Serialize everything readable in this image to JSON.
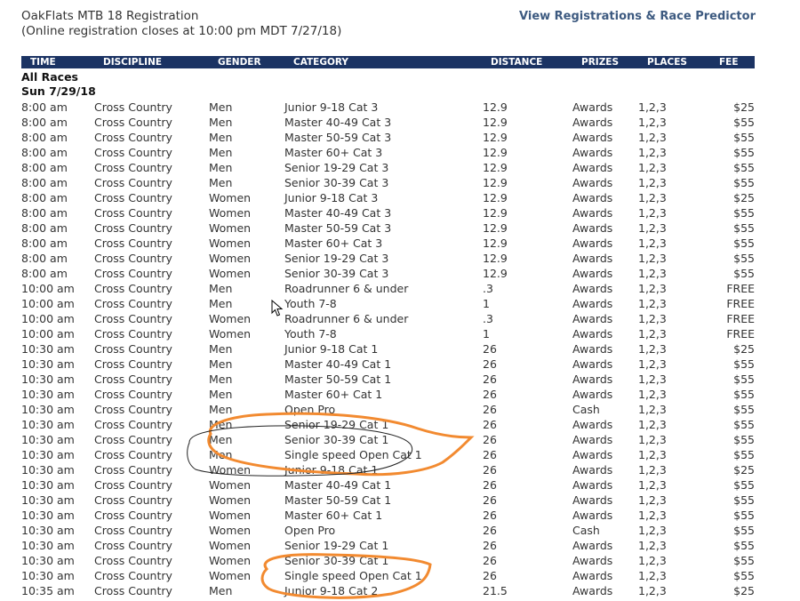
{
  "page": {
    "title": "OakFlats MTB 18 Registration",
    "subtitle": "(Online registration closes at 10:00 pm MDT 7/27/18)",
    "view_link": "View Registrations & Race Predictor"
  },
  "columns": {
    "time": "TIME",
    "discipline": "DISCIPLINE",
    "gender": "GENDER",
    "category": "CATEGORY",
    "distance": "DISTANCE",
    "prizes": "PRIZES",
    "places": "PLACES",
    "fee": "FEE"
  },
  "group": {
    "label": "All Races",
    "date": "Sun 7/29/18"
  },
  "rows": [
    [
      "8:00 am",
      "Cross Country",
      "Men",
      "Junior 9-18 Cat 3",
      "12.9",
      "Awards",
      "1,2,3",
      "$25"
    ],
    [
      "8:00 am",
      "Cross Country",
      "Men",
      "Master 40-49 Cat 3",
      "12.9",
      "Awards",
      "1,2,3",
      "$55"
    ],
    [
      "8:00 am",
      "Cross Country",
      "Men",
      "Master 50-59 Cat 3",
      "12.9",
      "Awards",
      "1,2,3",
      "$55"
    ],
    [
      "8:00 am",
      "Cross Country",
      "Men",
      "Master 60+ Cat 3",
      "12.9",
      "Awards",
      "1,2,3",
      "$55"
    ],
    [
      "8:00 am",
      "Cross Country",
      "Men",
      "Senior 19-29 Cat 3",
      "12.9",
      "Awards",
      "1,2,3",
      "$55"
    ],
    [
      "8:00 am",
      "Cross Country",
      "Men",
      "Senior 30-39 Cat 3",
      "12.9",
      "Awards",
      "1,2,3",
      "$55"
    ],
    [
      "8:00 am",
      "Cross Country",
      "Women",
      "Junior 9-18 Cat 3",
      "12.9",
      "Awards",
      "1,2,3",
      "$25"
    ],
    [
      "8:00 am",
      "Cross Country",
      "Women",
      "Master 40-49 Cat 3",
      "12.9",
      "Awards",
      "1,2,3",
      "$55"
    ],
    [
      "8:00 am",
      "Cross Country",
      "Women",
      "Master 50-59 Cat 3",
      "12.9",
      "Awards",
      "1,2,3",
      "$55"
    ],
    [
      "8:00 am",
      "Cross Country",
      "Women",
      "Master 60+ Cat 3",
      "12.9",
      "Awards",
      "1,2,3",
      "$55"
    ],
    [
      "8:00 am",
      "Cross Country",
      "Women",
      "Senior 19-29 Cat 3",
      "12.9",
      "Awards",
      "1,2,3",
      "$55"
    ],
    [
      "8:00 am",
      "Cross Country",
      "Women",
      "Senior 30-39 Cat 3",
      "12.9",
      "Awards",
      "1,2,3",
      "$55"
    ],
    [
      "10:00 am",
      "Cross Country",
      "Men",
      "Roadrunner 6 & under",
      ".3",
      "Awards",
      "1,2,3",
      "FREE"
    ],
    [
      "10:00 am",
      "Cross Country",
      "Men",
      "Youth 7-8",
      "1",
      "Awards",
      "1,2,3",
      "FREE"
    ],
    [
      "10:00 am",
      "Cross Country",
      "Women",
      "Roadrunner 6 & under",
      ".3",
      "Awards",
      "1,2,3",
      "FREE"
    ],
    [
      "10:00 am",
      "Cross Country",
      "Women",
      "Youth 7-8",
      "1",
      "Awards",
      "1,2,3",
      "FREE"
    ],
    [
      "10:30 am",
      "Cross Country",
      "Men",
      "Junior 9-18 Cat 1",
      "26",
      "Awards",
      "1,2,3",
      "$25"
    ],
    [
      "10:30 am",
      "Cross Country",
      "Men",
      "Master 40-49 Cat 1",
      "26",
      "Awards",
      "1,2,3",
      "$55"
    ],
    [
      "10:30 am",
      "Cross Country",
      "Men",
      "Master 50-59 Cat 1",
      "26",
      "Awards",
      "1,2,3",
      "$55"
    ],
    [
      "10:30 am",
      "Cross Country",
      "Men",
      "Master 60+ Cat 1",
      "26",
      "Awards",
      "1,2,3",
      "$55"
    ],
    [
      "10:30 am",
      "Cross Country",
      "Men",
      "Open Pro",
      "26",
      "Cash",
      "1,2,3",
      "$55"
    ],
    [
      "10:30 am",
      "Cross Country",
      "Men",
      "Senior 19-29 Cat 1",
      "26",
      "Awards",
      "1,2,3",
      "$55"
    ],
    [
      "10:30 am",
      "Cross Country",
      "Men",
      "Senior 30-39 Cat 1",
      "26",
      "Awards",
      "1,2,3",
      "$55"
    ],
    [
      "10:30 am",
      "Cross Country",
      "Men",
      "Single speed Open Cat 1",
      "26",
      "Awards",
      "1,2,3",
      "$55"
    ],
    [
      "10:30 am",
      "Cross Country",
      "Women",
      "Junior 9-18 Cat 1",
      "26",
      "Awards",
      "1,2,3",
      "$25"
    ],
    [
      "10:30 am",
      "Cross Country",
      "Women",
      "Master 40-49 Cat 1",
      "26",
      "Awards",
      "1,2,3",
      "$55"
    ],
    [
      "10:30 am",
      "Cross Country",
      "Women",
      "Master 50-59 Cat 1",
      "26",
      "Awards",
      "1,2,3",
      "$55"
    ],
    [
      "10:30 am",
      "Cross Country",
      "Women",
      "Master 60+ Cat 1",
      "26",
      "Awards",
      "1,2,3",
      "$55"
    ],
    [
      "10:30 am",
      "Cross Country",
      "Women",
      "Open Pro",
      "26",
      "Cash",
      "1,2,3",
      "$55"
    ],
    [
      "10:30 am",
      "Cross Country",
      "Women",
      "Senior 19-29 Cat 1",
      "26",
      "Awards",
      "1,2,3",
      "$55"
    ],
    [
      "10:30 am",
      "Cross Country",
      "Women",
      "Senior 30-39 Cat 1",
      "26",
      "Awards",
      "1,2,3",
      "$55"
    ],
    [
      "10:30 am",
      "Cross Country",
      "Women",
      "Single speed Open Cat 1",
      "26",
      "Awards",
      "1,2,3",
      "$55"
    ],
    [
      "10:35 am",
      "Cross Country",
      "Men",
      "Junior 9-18 Cat 2",
      "21.5",
      "Awards",
      "1,2,3",
      "$25"
    ]
  ],
  "annotation_colors": {
    "orange": "#f28a30",
    "black": "#222222"
  },
  "icons": {
    "cursor": "mouse-pointer-icon"
  }
}
